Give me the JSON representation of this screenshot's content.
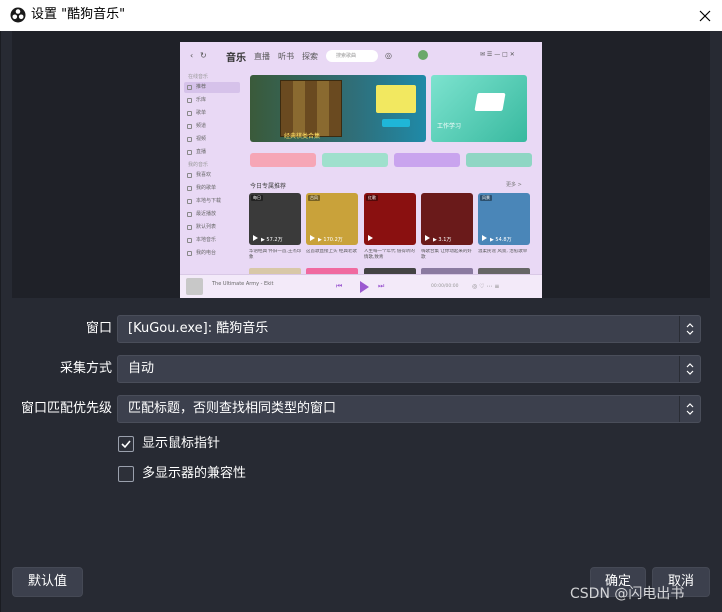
{
  "window": {
    "title": "设置 \"酷狗音乐\""
  },
  "preview": {
    "nav": [
      "音乐",
      "直播",
      "听书",
      "探索"
    ],
    "search_placeholder": "搜索歌曲",
    "sidebar_sections": [
      "在线音乐",
      "我的音乐"
    ],
    "sidebar_items_1": [
      "推荐",
      "乐库",
      "歌单",
      "频道",
      "视频",
      "直播"
    ],
    "sidebar_items_2": [
      "我喜欢",
      "我的歌单",
      "本地与下载",
      "最近播放",
      "默认列表",
      "本地音乐",
      "我的电台"
    ],
    "banner1_text": "经典棋类合集",
    "banner2_text": "工作学习",
    "section_title": "今日专属推荐",
    "section_more": "更多 >",
    "cards": [
      {
        "tag": "每日",
        "count": "▶ 57.2万",
        "caption": "华语经典 怀旧一首,王杰印象",
        "color": "#3a3a3a"
      },
      {
        "tag": "古风",
        "count": "▶ 170.2万",
        "caption": "这首歌直接上头 经典老歌",
        "color": "#c9a23a"
      },
      {
        "tag": "红歌",
        "count": "",
        "caption": "人生每一个年代 值得听的情歌,致青",
        "color": "#8a1010"
      },
      {
        "tag": "",
        "count": "▶ 3.1万",
        "caption": "嗨歌合集 让你动起来的好歌",
        "color": "#6a1a1a"
      },
      {
        "tag": "风景",
        "count": "▶ 54.8万",
        "caption": "温柔民谣 风景, 治愈歌单",
        "color": "#4a86b8"
      }
    ],
    "player_song": "The Ultimate Army - Ekit",
    "player_time": "00:00/00:00"
  },
  "form": {
    "window_label": "窗口",
    "window_value": "[KuGou.exe]: 酷狗音乐",
    "capture_label": "采集方式",
    "capture_value": "自动",
    "priority_label": "窗口匹配优先级",
    "priority_value": "匹配标题，否则查找相同类型的窗口",
    "cursor_label": "显示鼠标指针",
    "cursor_checked": true,
    "multi_label": "多显示器的兼容性",
    "multi_checked": false
  },
  "buttons": {
    "defaults": "默认值",
    "ok": "确定",
    "cancel": "取消"
  },
  "watermark": "CSDN @闪电出书"
}
